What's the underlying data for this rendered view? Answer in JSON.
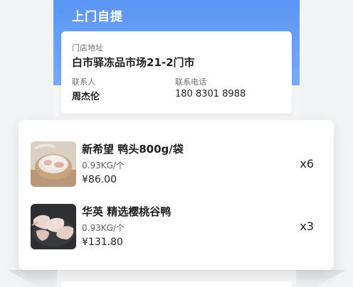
{
  "header": {
    "title": "上门自提"
  },
  "store": {
    "address_label": "门店地址",
    "address": "白市驿冻品市场21-2门市",
    "contact_label": "联系人",
    "contact_name": "周杰伦",
    "phone_label": "联系电话",
    "phone": "180 8301 8988"
  },
  "products": [
    {
      "name": "新希望 鸭头800g/袋",
      "spec": "0.93KG/个",
      "price": "¥86.00",
      "qty": "x6",
      "image": "duck-head-bag-image"
    },
    {
      "name": "华英 精选樱桃谷鸭",
      "spec": "0.93KG/个",
      "price": "¥131.80",
      "qty": "x3",
      "image": "duck-heads-plate-image"
    }
  ],
  "colors": {
    "header_blue": "#5a95f5",
    "card_bg": "#ffffff",
    "page_bg": "#f4f5f7"
  }
}
